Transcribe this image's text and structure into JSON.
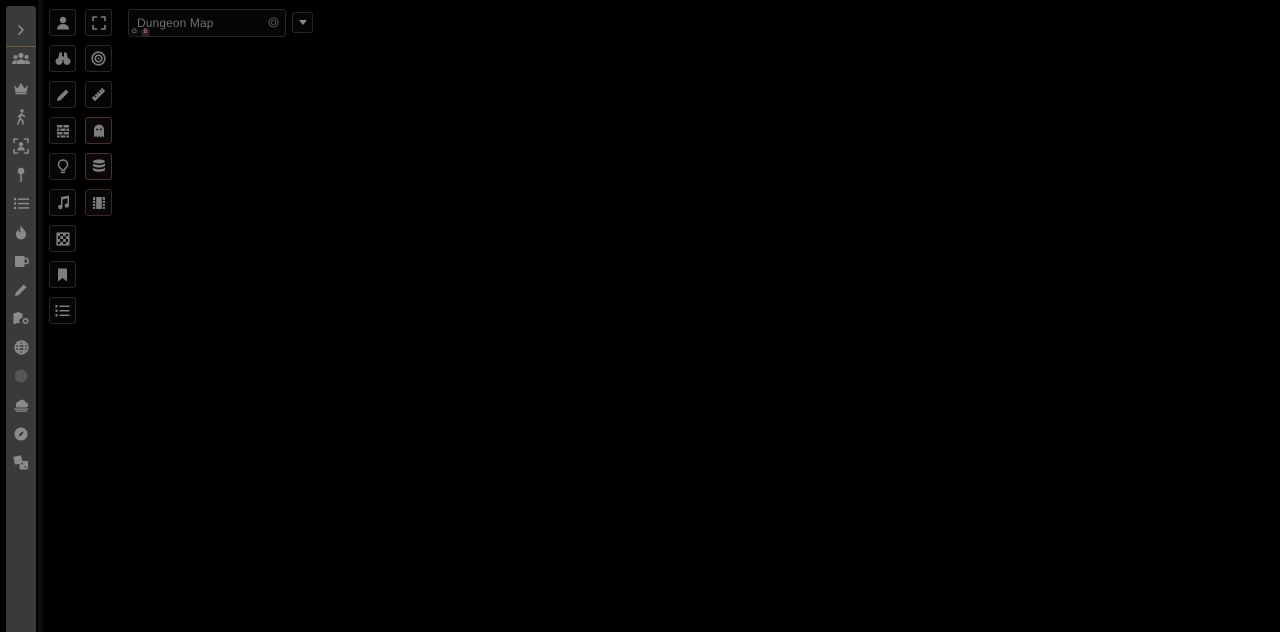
{
  "map": {
    "name": "Dungeon Map",
    "badges": [
      "G",
      "B"
    ]
  },
  "sidebar": {
    "items": [
      {
        "icon": "party-icon"
      },
      {
        "icon": "crown-icon"
      },
      {
        "icon": "walking-person-icon"
      },
      {
        "icon": "face-scan-icon"
      },
      {
        "icon": "map-pin-icon"
      },
      {
        "icon": "list-icon"
      },
      {
        "icon": "fire-icon"
      },
      {
        "icon": "mug-icon"
      },
      {
        "icon": "pencil-icon"
      },
      {
        "icon": "map-settings-icon"
      },
      {
        "icon": "globe-icon"
      },
      {
        "icon": "info-icon"
      },
      {
        "icon": "cloud-icon"
      },
      {
        "icon": "compass-icon"
      },
      {
        "icon": "dice-icon"
      }
    ]
  },
  "colors": {
    "background": "#000000",
    "sidebar": "#3a3a3a",
    "icon": "#7d7d7d",
    "accent_border": "#4a3030"
  }
}
